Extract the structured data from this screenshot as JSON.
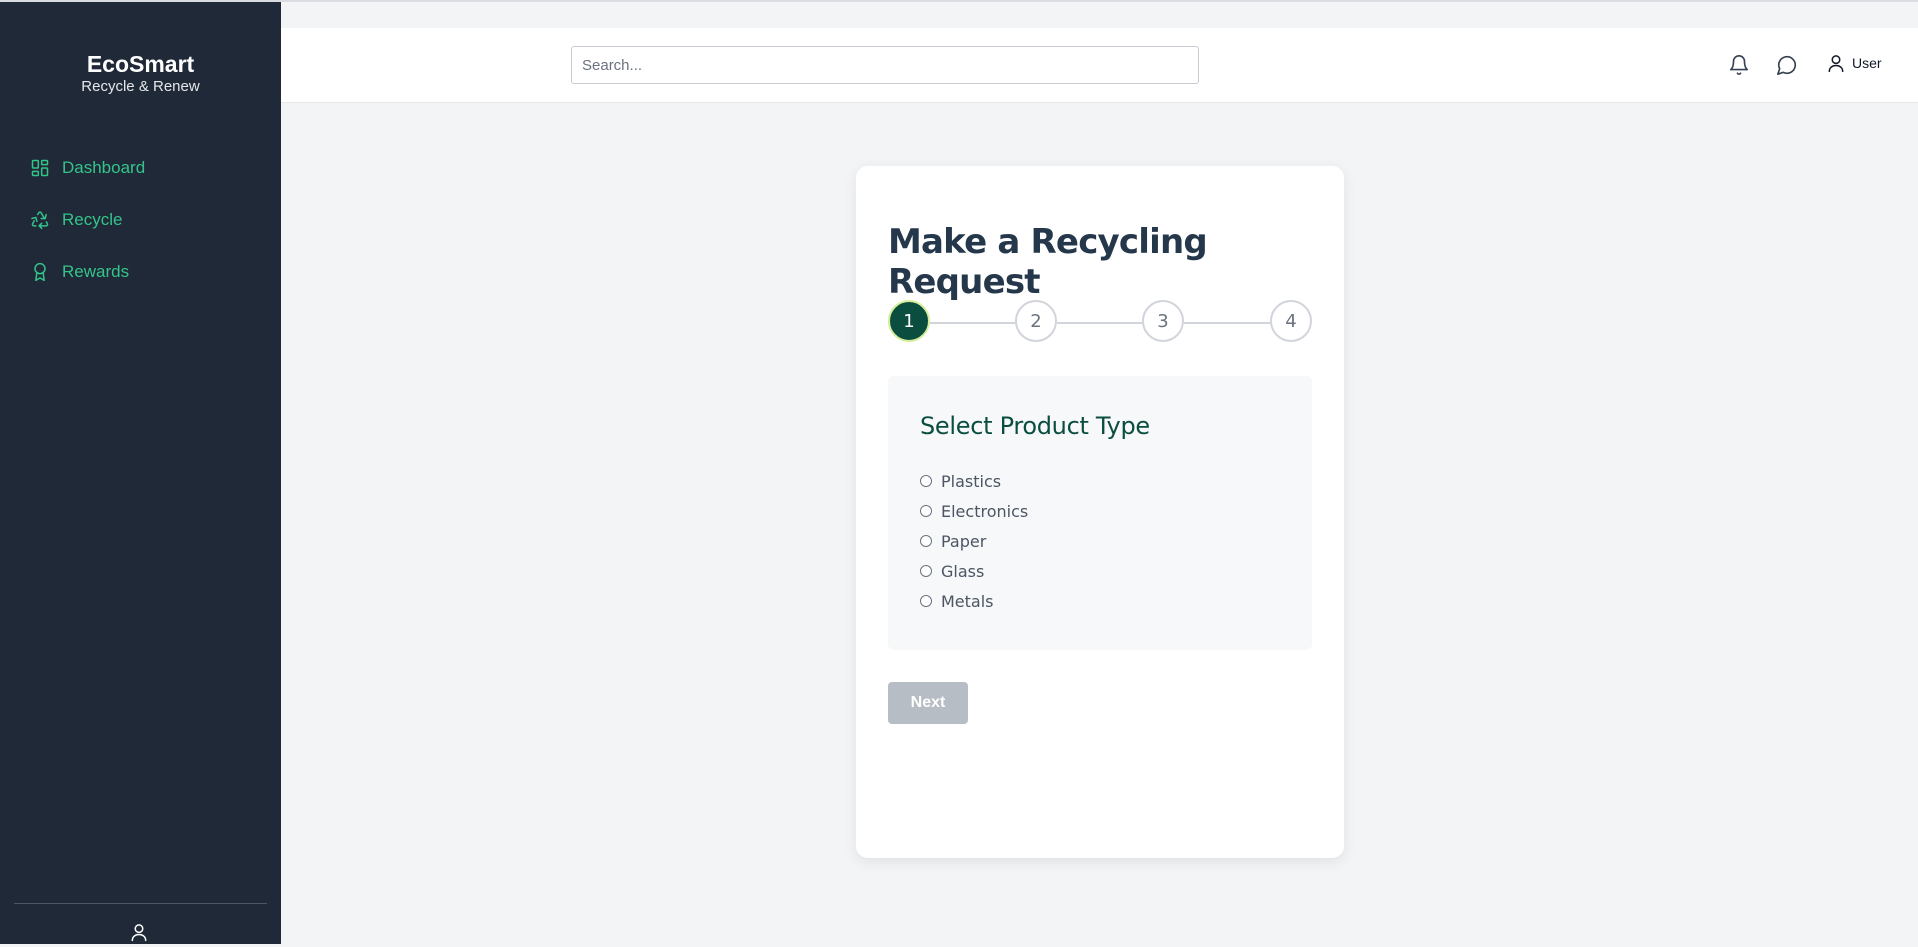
{
  "brand": {
    "title": "EcoSmart",
    "subtitle": "Recycle & Renew"
  },
  "sidebar": {
    "items": [
      {
        "label": "Dashboard",
        "icon": "dashboard-grid-icon"
      },
      {
        "label": "Recycle",
        "icon": "recycle-icon"
      },
      {
        "label": "Rewards",
        "icon": "award-icon"
      }
    ],
    "footer_icon": "user-icon"
  },
  "header": {
    "search": {
      "placeholder": "Search...",
      "value": ""
    },
    "icons": [
      "bell-icon",
      "chat-icon",
      "user-icon"
    ],
    "user_label": "User"
  },
  "form": {
    "title": "Make a Recycling Request",
    "steps": [
      "1",
      "2",
      "3",
      "4"
    ],
    "active_step": 1,
    "section_title": "Select Product Type",
    "options": [
      "Plastics",
      "Electronics",
      "Paper",
      "Glass",
      "Metals"
    ],
    "next_label": "Next"
  },
  "colors": {
    "sidebar_bg": "#1f2937",
    "accent_green": "#34c48a",
    "dark_green": "#0b4d3f",
    "page_bg": "#f3f4f6",
    "disabled_button": "#b7bdc4"
  }
}
